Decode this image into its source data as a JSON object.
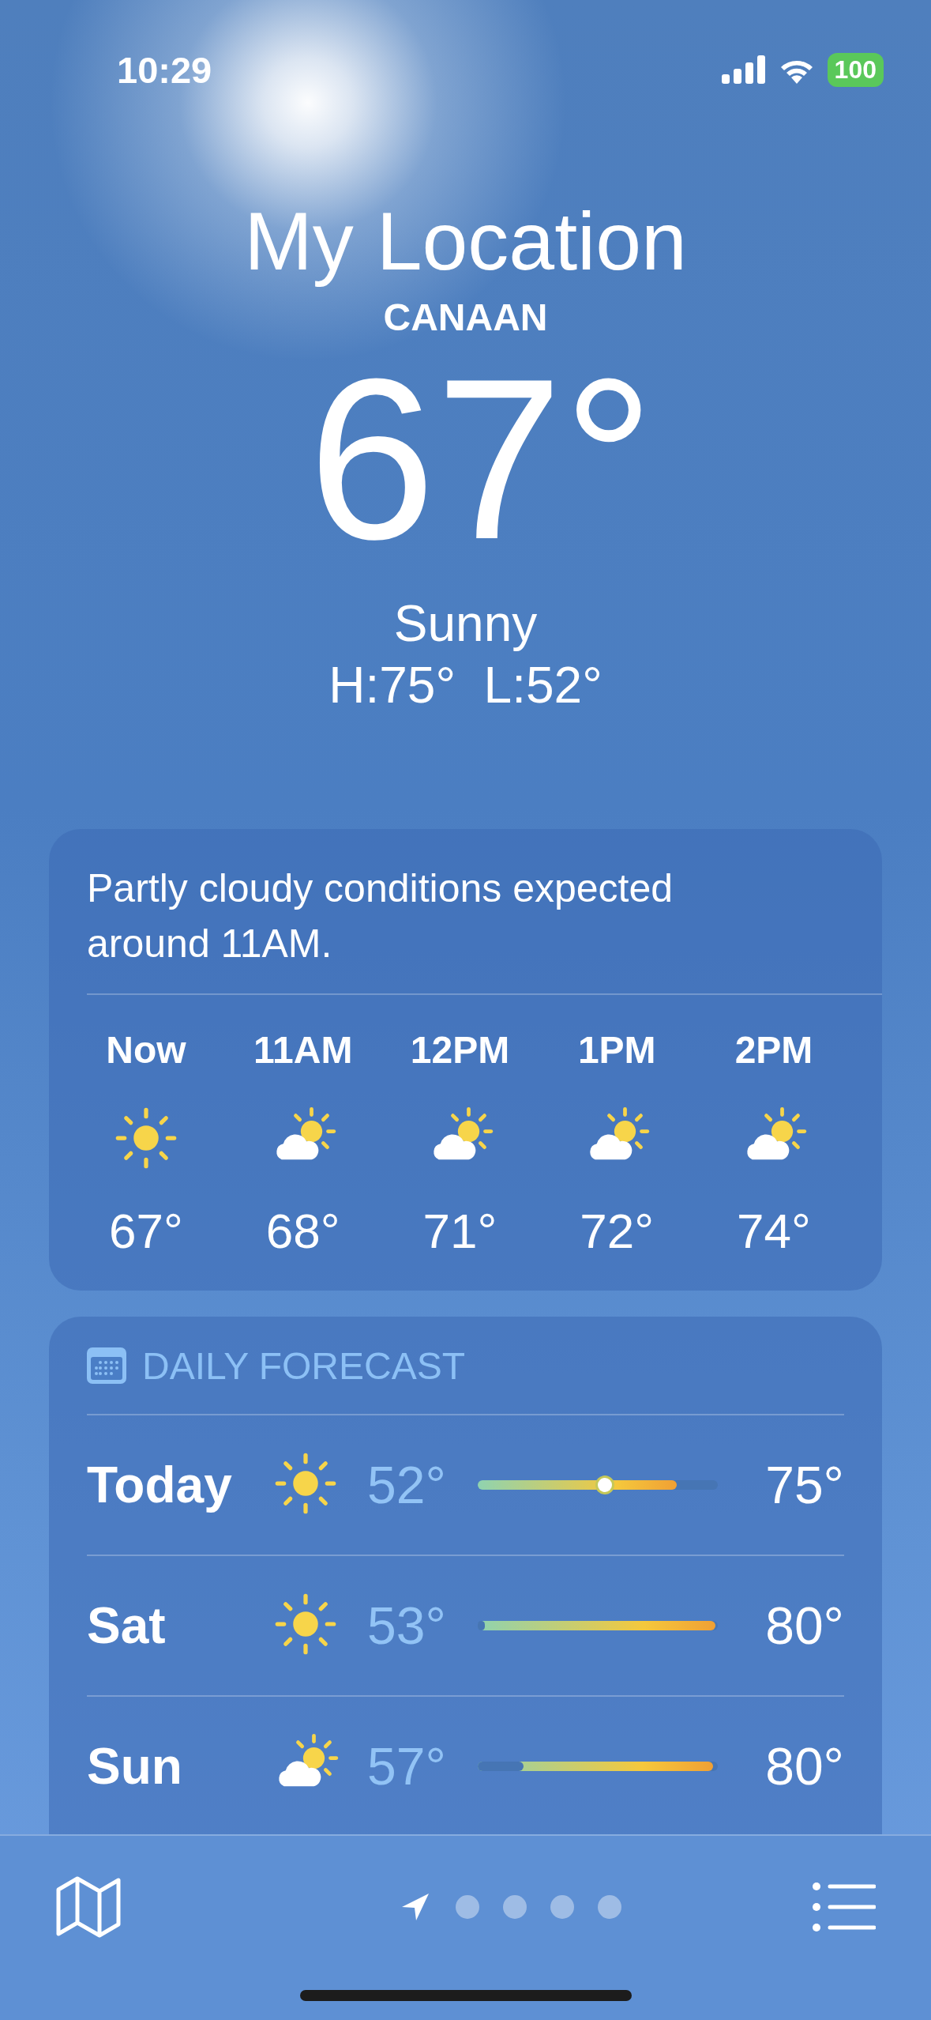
{
  "status_bar": {
    "time": "10:29",
    "battery": "100"
  },
  "location": {
    "title": "My Location",
    "place": "CANAAN",
    "temperature": "67°",
    "condition": "Sunny",
    "high_low": "H:75°  L:52°"
  },
  "hourly": {
    "summary": "Partly cloudy conditions expected around 11AM.",
    "hours": [
      {
        "label": "Now",
        "kind": "sunny",
        "temp": "67°"
      },
      {
        "label": "11AM",
        "kind": "partly-cloudy",
        "temp": "68°"
      },
      {
        "label": "12PM",
        "kind": "partly-cloudy",
        "temp": "71°"
      },
      {
        "label": "1PM",
        "kind": "partly-cloudy",
        "temp": "72°"
      },
      {
        "label": "2PM",
        "kind": "partly-cloudy",
        "temp": "74°"
      }
    ]
  },
  "daily": {
    "title": "DAILY FORECAST",
    "days": [
      {
        "day": "Today",
        "kind": "sunny",
        "low": "52°",
        "high": "75°",
        "range": {
          "to": {
            "level": 0.83
          }
        },
        "current": {
          "level": 0.53
        }
      },
      {
        "day": "Sat",
        "kind": "sunny",
        "low": "53°",
        "high": "80°",
        "range": {
          "from": {
            "level": 0.03
          },
          "to": {
            "level": 0.99
          }
        }
      },
      {
        "day": "Sun",
        "kind": "partly-cloudy",
        "low": "57°",
        "high": "80°",
        "range": {
          "from": {
            "level": 0.19
          },
          "to": {
            "level": 0.98
          }
        }
      }
    ]
  },
  "page_dots": [
    {
      "kind": "location",
      "selected": true
    },
    {
      "kind": "dot",
      "selected": false
    },
    {
      "kind": "dot",
      "selected": false
    },
    {
      "kind": "dot",
      "selected": false
    },
    {
      "kind": "dot",
      "selected": false
    }
  ]
}
